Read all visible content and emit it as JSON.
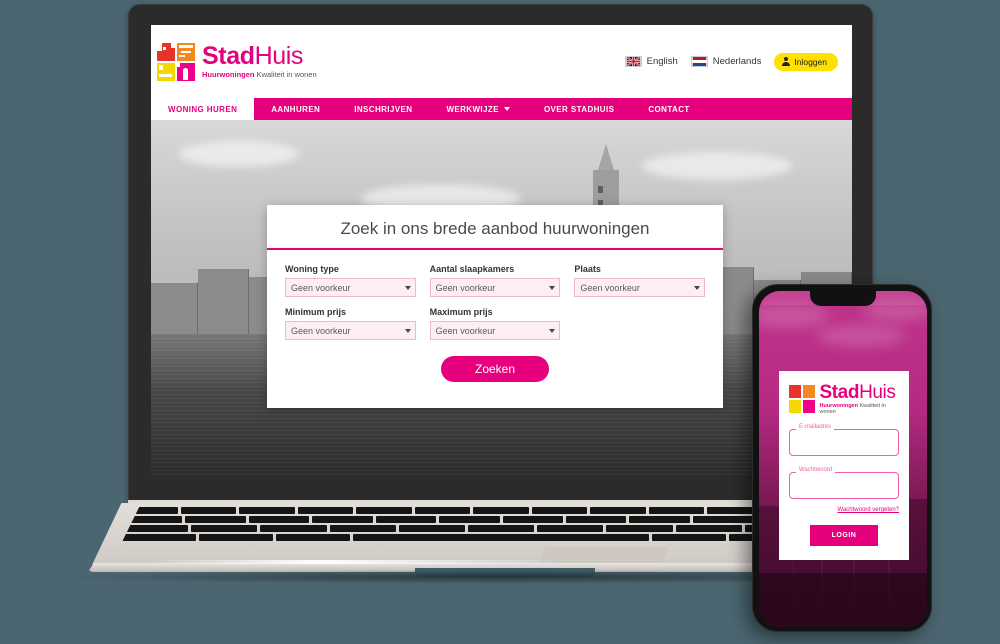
{
  "background_color": "#4c6671",
  "brand": {
    "primary_pink": "#e6007e",
    "accent_yellow": "#ffe000",
    "logo_name_bold": "Stad",
    "logo_name_light": "Huis",
    "logo_tagline_bold": "Huurwoningen",
    "logo_tagline_rest": "Kwaliteit in wonen",
    "tiles": [
      {
        "name": "tile-red-house",
        "color": "#e8332a"
      },
      {
        "name": "tile-orange",
        "color": "#f5881f"
      },
      {
        "name": "tile-yellow",
        "color": "#f5d800"
      },
      {
        "name": "tile-pink-arch",
        "color": "#ec008c"
      }
    ]
  },
  "laptop": {
    "header": {
      "languages": [
        {
          "label": "English",
          "flag": "uk-flag-icon"
        },
        {
          "label": "Nederlands",
          "flag": "nl-flag-icon"
        }
      ],
      "login_button": "Inloggen"
    },
    "nav": {
      "items": [
        {
          "label": "WONING HUREN",
          "active": true,
          "has_caret": false
        },
        {
          "label": "AANHUREN",
          "active": false,
          "has_caret": false
        },
        {
          "label": "INSCHRIJVEN",
          "active": false,
          "has_caret": false
        },
        {
          "label": "WERKWIJZE",
          "active": false,
          "has_caret": true
        },
        {
          "label": "OVER STADHUIS",
          "active": false,
          "has_caret": false
        },
        {
          "label": "CONTACT",
          "active": false,
          "has_caret": false
        }
      ]
    },
    "search_card": {
      "title": "Zoek in ons brede aanbod huurwoningen",
      "fields": [
        {
          "label": "Woning type",
          "value": "Geen voorkeur"
        },
        {
          "label": "Aantal slaapkamers",
          "value": "Geen voorkeur"
        },
        {
          "label": "Plaats",
          "value": "Geen voorkeur"
        },
        {
          "label": "Minimum prijs",
          "value": "Geen voorkeur"
        },
        {
          "label": "Maximum prijs",
          "value": "Geen voorkeur"
        }
      ],
      "submit_label": "Zoeken"
    }
  },
  "phone": {
    "login": {
      "email_label": "E-mailadres",
      "email_value": "",
      "password_label": "Wachtwoord",
      "password_value": "",
      "forgot_link": "Wachtwoord vergeten?",
      "submit_label": "LOGIN"
    }
  }
}
